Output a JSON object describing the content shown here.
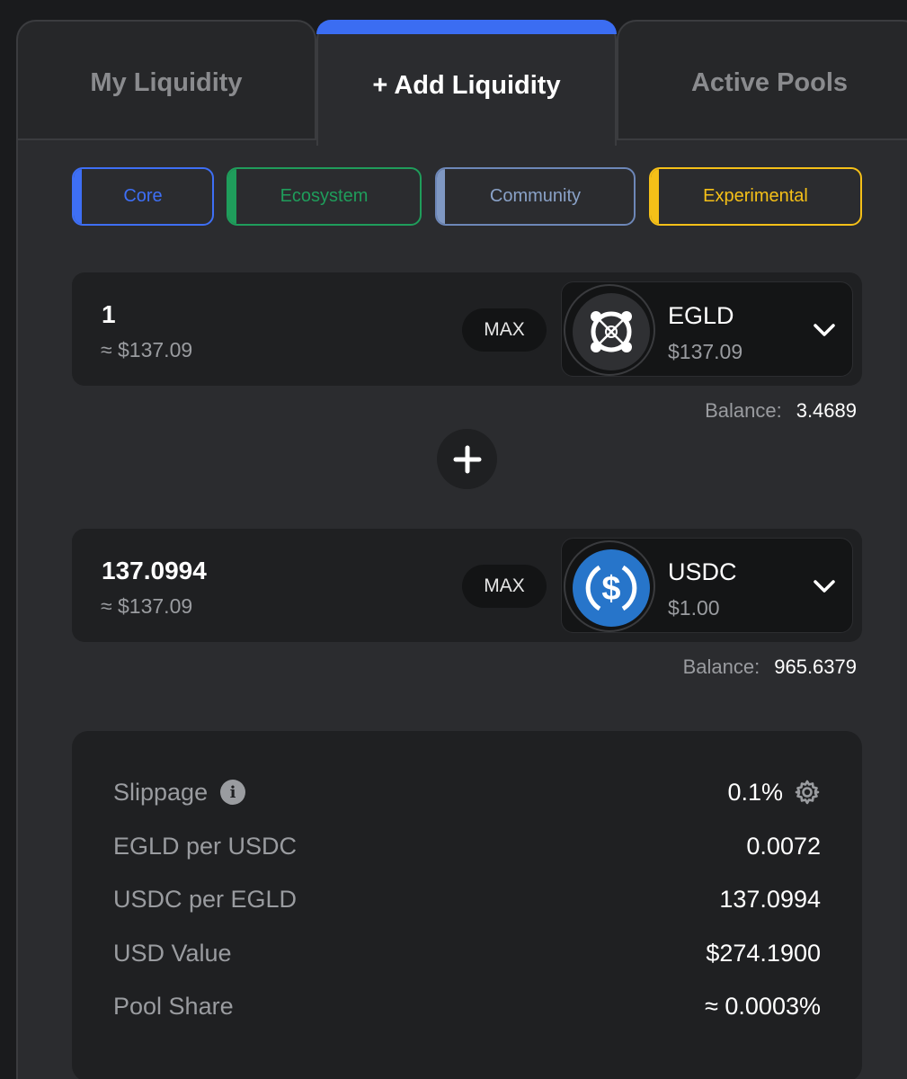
{
  "tabs": {
    "my_liquidity": "My Liquidity",
    "add_liquidity": "+ Add Liquidity",
    "active_pools": "Active Pools",
    "selected": "add_liquidity",
    "accent_color": "#3b6df2"
  },
  "categories": [
    {
      "label": "Core",
      "color": "#3e6ff5"
    },
    {
      "label": "Ecosystem",
      "color": "#1f9d5b"
    },
    {
      "label": "Community",
      "color": "#7f98c3"
    },
    {
      "label": "Experimental",
      "color": "#f5c018"
    }
  ],
  "token_a": {
    "amount": "1",
    "usd_approx": "≈ $137.09",
    "max_label": "MAX",
    "symbol": "EGLD",
    "price": "$137.09",
    "icon": "egld-logo-icon",
    "balance_label": "Balance:",
    "balance_value": "3.4689"
  },
  "token_b": {
    "amount": "137.0994",
    "usd_approx": "≈ $137.09",
    "max_label": "MAX",
    "symbol": "USDC",
    "price": "$1.00",
    "icon": "usdc-logo-icon",
    "brand_color": "#2775ca",
    "balance_label": "Balance:",
    "balance_value": "965.6379"
  },
  "plus_icon": "plus-icon",
  "summary": {
    "slippage_label": "Slippage",
    "slippage_value": "0.1%",
    "egld_per_usdc_label": "EGLD per USDC",
    "egld_per_usdc_value": "0.0072",
    "usdc_per_egld_label": "USDC per EGLD",
    "usdc_per_egld_value": "137.0994",
    "usd_value_label": "USD Value",
    "usd_value_value": "$274.1900",
    "pool_share_label": "Pool Share",
    "pool_share_value": "≈ 0.0003%"
  }
}
